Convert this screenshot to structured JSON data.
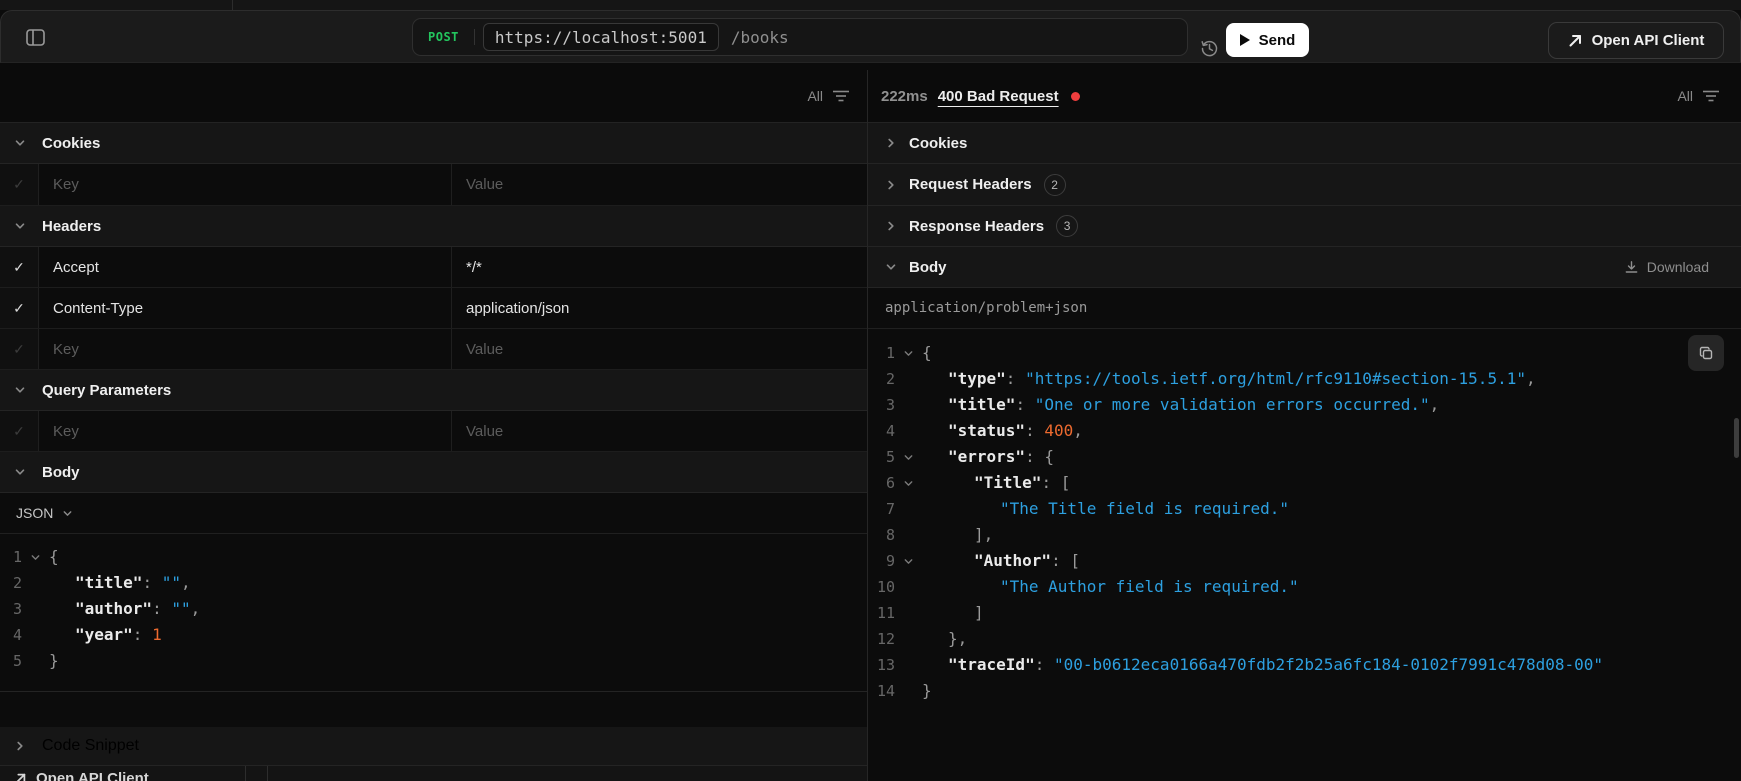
{
  "topbar": {
    "method": "POST",
    "base_url": "https://localhost:5001",
    "path": "/books",
    "send_label": "Send",
    "open_api_client_label": "Open API Client"
  },
  "request": {
    "filter_all": "All",
    "sections": {
      "cookies": "Cookies",
      "headers": "Headers",
      "query_parameters": "Query Parameters",
      "body": "Body",
      "code_snippet": "Code Snippet"
    },
    "placeholders": {
      "key": "Key",
      "value": "Value"
    },
    "header_rows": [
      {
        "key": "Accept",
        "value": "*/*"
      },
      {
        "key": "Content-Type",
        "value": "application/json"
      }
    ],
    "body_format": "JSON",
    "code_lines": [
      {
        "n": 1,
        "indent": 0,
        "fold": true,
        "tokens": [
          [
            "p",
            "{"
          ]
        ]
      },
      {
        "n": 2,
        "indent": 1,
        "tokens": [
          [
            "k",
            "\"title\""
          ],
          [
            "p",
            ": "
          ],
          [
            "s",
            "\"\""
          ],
          [
            "p",
            ","
          ]
        ]
      },
      {
        "n": 3,
        "indent": 1,
        "tokens": [
          [
            "k",
            "\"author\""
          ],
          [
            "p",
            ": "
          ],
          [
            "s",
            "\"\""
          ],
          [
            "p",
            ","
          ]
        ]
      },
      {
        "n": 4,
        "indent": 1,
        "tokens": [
          [
            "k",
            "\"year\""
          ],
          [
            "p",
            ": "
          ],
          [
            "n",
            "1"
          ]
        ]
      },
      {
        "n": 5,
        "indent": 0,
        "tokens": [
          [
            "p",
            "}"
          ]
        ]
      }
    ]
  },
  "response": {
    "duration": "222ms",
    "status_text": "400 Bad Request",
    "filter_all": "All",
    "sections": [
      {
        "title": "Cookies"
      },
      {
        "title": "Request Headers",
        "badge": "2"
      },
      {
        "title": "Response Headers",
        "badge": "3"
      },
      {
        "title": "Body"
      }
    ],
    "download_label": "Download",
    "content_type": "application/problem+json",
    "code_lines": [
      {
        "n": 1,
        "indent": 0,
        "fold": true,
        "tokens": [
          [
            "p",
            "{"
          ]
        ]
      },
      {
        "n": 2,
        "indent": 1,
        "tokens": [
          [
            "k",
            "\"type\""
          ],
          [
            "p",
            ": "
          ],
          [
            "s",
            "\"https://tools.ietf.org/html/rfc9110#section-15.5.1\""
          ],
          [
            "p",
            ","
          ]
        ]
      },
      {
        "n": 3,
        "indent": 1,
        "tokens": [
          [
            "k",
            "\"title\""
          ],
          [
            "p",
            ": "
          ],
          [
            "s",
            "\"One or more validation errors occurred.\""
          ],
          [
            "p",
            ","
          ]
        ]
      },
      {
        "n": 4,
        "indent": 1,
        "tokens": [
          [
            "k",
            "\"status\""
          ],
          [
            "p",
            ": "
          ],
          [
            "n",
            "400"
          ],
          [
            "p",
            ","
          ]
        ]
      },
      {
        "n": 5,
        "indent": 1,
        "fold": true,
        "tokens": [
          [
            "k",
            "\"errors\""
          ],
          [
            "p",
            ": "
          ],
          [
            "p",
            "{"
          ]
        ]
      },
      {
        "n": 6,
        "indent": 2,
        "fold": true,
        "tokens": [
          [
            "k",
            "\"Title\""
          ],
          [
            "p",
            ": "
          ],
          [
            "p",
            "["
          ]
        ]
      },
      {
        "n": 7,
        "indent": 3,
        "tokens": [
          [
            "s",
            "\"The Title field is required.\""
          ]
        ]
      },
      {
        "n": 8,
        "indent": 2,
        "tokens": [
          [
            "p",
            "],"
          ]
        ]
      },
      {
        "n": 9,
        "indent": 2,
        "fold": true,
        "tokens": [
          [
            "k",
            "\"Author\""
          ],
          [
            "p",
            ": "
          ],
          [
            "p",
            "["
          ]
        ]
      },
      {
        "n": 10,
        "indent": 3,
        "tokens": [
          [
            "s",
            "\"The Author field is required.\""
          ]
        ]
      },
      {
        "n": 11,
        "indent": 2,
        "tokens": [
          [
            "p",
            "]"
          ]
        ]
      },
      {
        "n": 12,
        "indent": 1,
        "tokens": [
          [
            "p",
            "},"
          ]
        ]
      },
      {
        "n": 13,
        "indent": 1,
        "tokens": [
          [
            "k",
            "\"traceId\""
          ],
          [
            "p",
            ": "
          ],
          [
            "s",
            "\"00-b0612eca0166a470fdb2f2b25a6fc184-0102f7991c478d08-00\""
          ]
        ]
      },
      {
        "n": 14,
        "indent": 0,
        "tokens": [
          [
            "p",
            "}"
          ]
        ]
      }
    ]
  },
  "bottom": {
    "open_api_client_label": "Open API Client"
  },
  "colors": {
    "method_green": "#23c55e",
    "string_blue": "#2da0e0",
    "number_orange": "#ed6a2f",
    "status_dot_red": "#f03e3e"
  }
}
